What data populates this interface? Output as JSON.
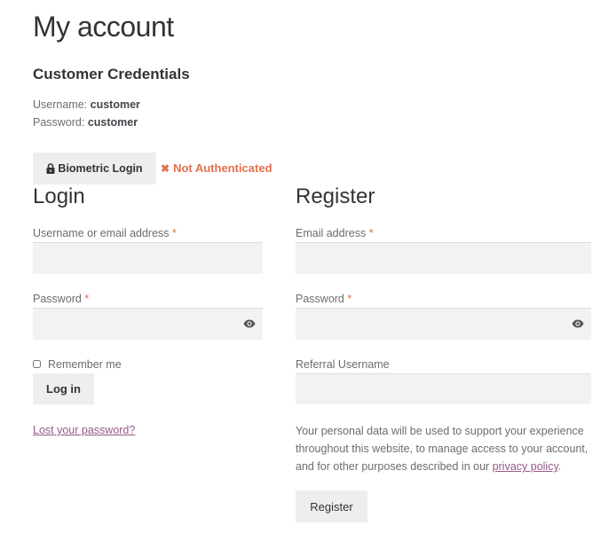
{
  "page": {
    "title": "My account"
  },
  "credentials": {
    "title": "Customer Credentials",
    "username_label": "Username:",
    "username_value": "customer",
    "password_label": "Password:",
    "password_value": "customer"
  },
  "biometric": {
    "button_label": "Biometric Login",
    "status_icon": "✖",
    "status_text": "Not Authenticated",
    "status_color": "#e2714d"
  },
  "login": {
    "title": "Login",
    "username_label": "Username or email address",
    "username_value": "",
    "password_label": "Password",
    "password_value": "",
    "required_mark": "*",
    "remember_label": "Remember me",
    "remember_checked": false,
    "submit_label": "Log in",
    "lost_password_label": "Lost your password?"
  },
  "register": {
    "title": "Register",
    "email_label": "Email address",
    "email_value": "",
    "password_label": "Password",
    "password_value": "",
    "required_mark": "*",
    "referral_label": "Referral Username",
    "referral_value": "",
    "privacy_text": "Your personal data will be used to support your experience throughout this website, to manage access to your account, and for other purposes described in our ",
    "privacy_link": "privacy policy",
    "privacy_end": ".",
    "submit_label": "Register"
  },
  "colors": {
    "accent_link": "#96588a",
    "required": "#e2714d",
    "input_bg": "#f2f2f2",
    "button_bg": "#eeeeee"
  }
}
